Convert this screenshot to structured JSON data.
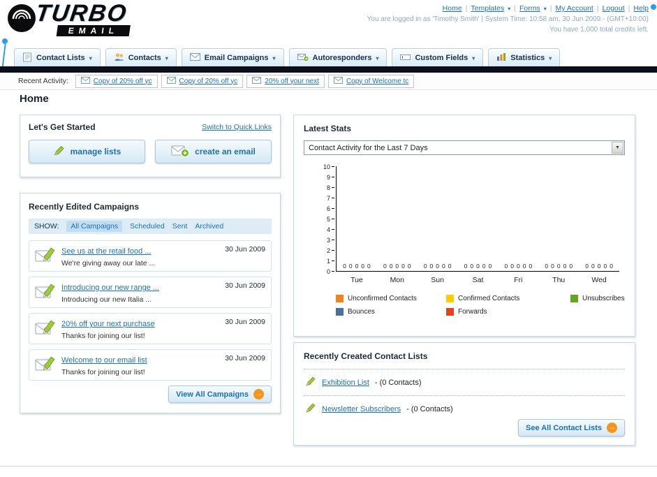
{
  "header": {
    "logo": {
      "line1": "TURBO",
      "line2": "EMAIL"
    },
    "nav_links": [
      "Home",
      "Templates",
      "Forms",
      "My Account",
      "Logout",
      "Help"
    ],
    "login_info": "You are logged in as 'Timothy Smith' | System Time: 10:58 am, 30 Jun 2009 - (GMT+10:00)",
    "credits_info": "You have 1,000 total credits left."
  },
  "nav_tabs": [
    {
      "label": "Contact Lists"
    },
    {
      "label": "Contacts"
    },
    {
      "label": "Email Campaigns"
    },
    {
      "label": "Autoresponders"
    },
    {
      "label": "Custom Fields"
    },
    {
      "label": "Statistics"
    }
  ],
  "recent_activity": {
    "label": "Recent Activity:",
    "items": [
      {
        "text": "Copy of 20% off yc"
      },
      {
        "text": "Copy of 20% off yc"
      },
      {
        "text": "20% off your next"
      },
      {
        "text": "Copy of Welcome tc"
      }
    ]
  },
  "page_title": "Home",
  "get_started": {
    "title": "Let's Get Started",
    "switch_link": "Switch to Quick Links",
    "manage_lists_label": "manage lists",
    "create_email_label": "create an email"
  },
  "campaigns": {
    "title": "Recently Edited Campaigns",
    "show_label": "SHOW:",
    "filters": [
      {
        "label": "All Campaigns"
      },
      {
        "label": "Scheduled"
      },
      {
        "label": "Sent"
      },
      {
        "label": "Archived"
      }
    ],
    "items": [
      {
        "title": "See us at the retail food ...",
        "subtitle": "We're giving away our late ...",
        "date": "30 Jun 2009"
      },
      {
        "title": "Introducing our new range ...",
        "subtitle": "Introducing our new Italia ...",
        "date": "30 Jun 2009"
      },
      {
        "title": "20% off your next purchase",
        "subtitle": "Thanks for joining our list!",
        "date": "30 Jun 2009"
      },
      {
        "title": "Welcome to our email list",
        "subtitle": "Thanks for joining our list!",
        "date": "30 Jun 2009"
      }
    ],
    "view_all_label": "View All Campaigns"
  },
  "stats": {
    "title": "Latest Stats",
    "dropdown_value": "Contact Activity for the Last 7 Days",
    "chart_data": {
      "type": "bar",
      "title": "Contact Activity for the Last 7 Days",
      "categories": [
        "Tue",
        "Mon",
        "Sun",
        "Sat",
        "Fri",
        "Thu",
        "Wed"
      ],
      "series": [
        {
          "name": "Unconfirmed Contacts",
          "color": "#f5821f",
          "values": [
            0,
            0,
            0,
            0,
            0,
            0,
            0
          ]
        },
        {
          "name": "Confirmed Contacts",
          "color": "#ffcc00",
          "values": [
            0,
            0,
            0,
            0,
            0,
            0,
            0
          ]
        },
        {
          "name": "Unsubscribes",
          "color": "#61a521",
          "values": [
            0,
            0,
            0,
            0,
            0,
            0,
            0
          ]
        },
        {
          "name": "Bounces",
          "color": "#4a6e9e",
          "values": [
            0,
            0,
            0,
            0,
            0,
            0,
            0
          ]
        },
        {
          "name": "Forwards",
          "color": "#e8431f",
          "values": [
            0,
            0,
            0,
            0,
            0,
            0,
            0
          ]
        }
      ],
      "ylim": [
        0,
        10
      ],
      "grid": false,
      "legend_position": "bottom"
    }
  },
  "contact_lists": {
    "title": "Recently Created Contact Lists",
    "items": [
      {
        "name": "Exhibition List",
        "detail": "- (0 Contacts)"
      },
      {
        "name": "Newsletter Subscribers",
        "detail": "- (0 Contacts)"
      }
    ],
    "see_all_label": "See All Contact Lists"
  }
}
